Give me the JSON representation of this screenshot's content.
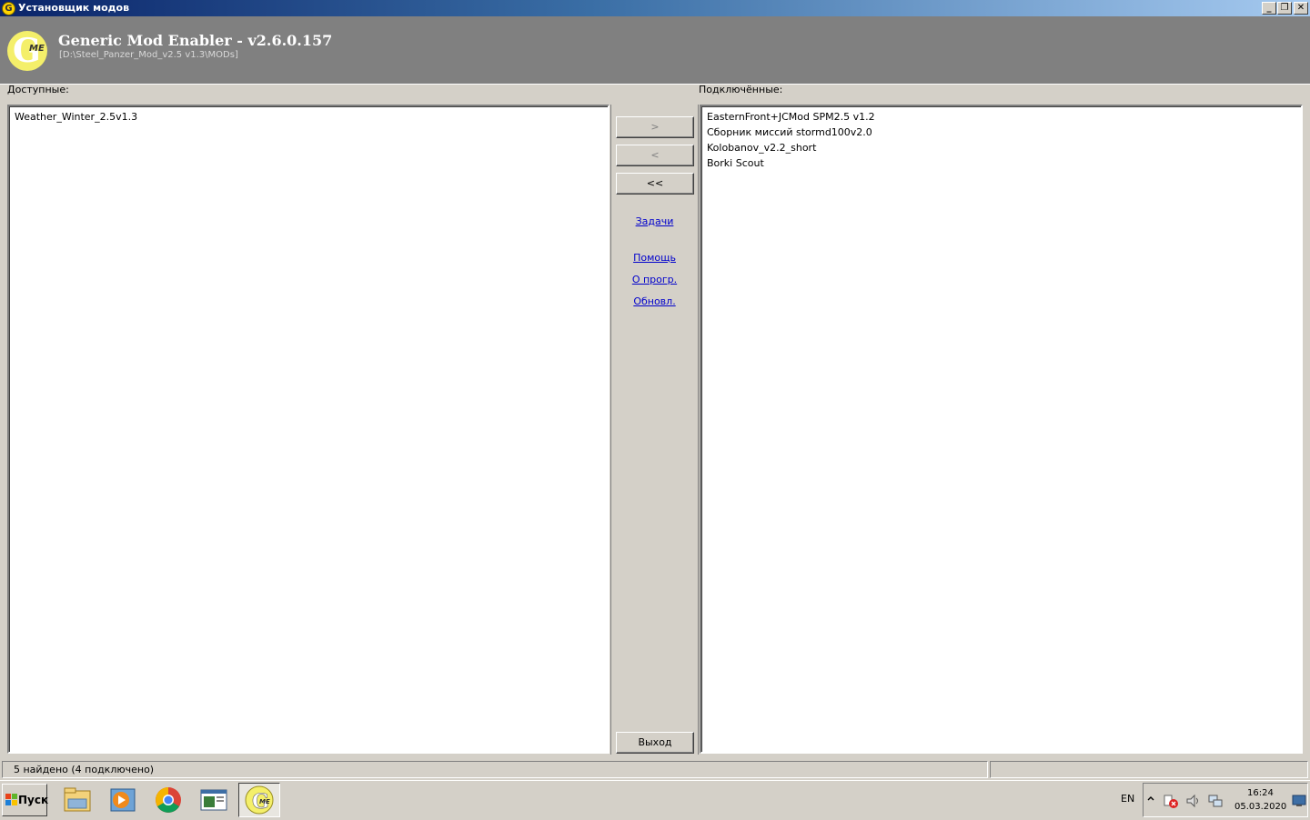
{
  "window": {
    "title": "Установщик модов",
    "controls": {
      "minimize": "_",
      "restore": "❐",
      "close": "✕"
    }
  },
  "header": {
    "logo_text": "G",
    "logo_sub": "ME",
    "app_title": "Generic Mod Enabler - v2.6.0.157",
    "path": "[D:\\Steel_Panzer_Mod_v2.5 v1.3\\MODs]"
  },
  "available": {
    "label": "Доступные:",
    "items": [
      "Weather_Winter_2.5v1.3"
    ]
  },
  "installed": {
    "label": "Подключённые:",
    "items": [
      "EasternFront+JCMod SPM2.5 v1.2",
      "Сборник миссий stormd100v2.0",
      "Kolobanov_v2.2_short",
      "Borki Scout"
    ]
  },
  "buttons": {
    "activate": ">",
    "deactivate": "<",
    "deactivate_all": "<<",
    "exit": "Выход"
  },
  "links": {
    "tasks": "Задачи",
    "help": "Помощь",
    "about": "О прогр.",
    "update": "Обновл."
  },
  "status": {
    "summary": "5 найдено  (4 подключено)",
    "right": ""
  },
  "taskbar": {
    "start_label": "Пуск",
    "apps": [
      "file-manager-icon",
      "media-player-icon",
      "chrome-icon",
      "window-app-icon",
      "gme-icon"
    ],
    "language": "EN",
    "time": "16:24",
    "date": "05.03.2020"
  },
  "colors": {
    "header_bg": "#808080",
    "logo_yellow": "#f4ef6a",
    "link_blue": "#0000cc",
    "face": "#d4d0c8"
  }
}
